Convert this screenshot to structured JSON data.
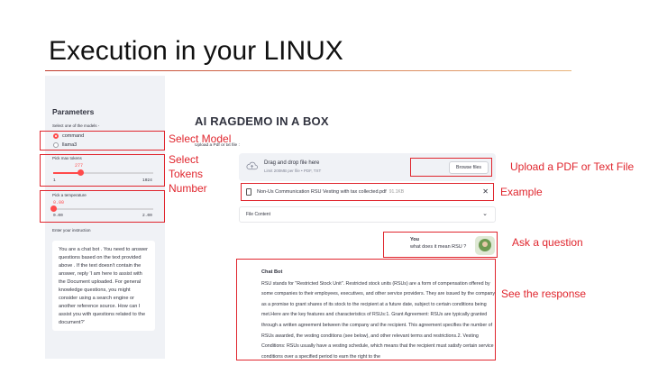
{
  "slide": {
    "title": "Execution in your LINUX"
  },
  "sidebar": {
    "title": "Parameters",
    "model_label": "Select one of the models -",
    "models": [
      "command",
      "llama3"
    ],
    "selected_model": "command",
    "tokens": {
      "label": "Pick max tokens",
      "value": "277",
      "min": "1",
      "max": "1024",
      "fraction": 0.27
    },
    "temperature": {
      "label": "Pick a temperature",
      "value": "0.00",
      "min": "0.00",
      "max": "2.00",
      "fraction": 0.0
    },
    "instruction_label": "Enter your instruction",
    "instruction_text": "You are a chat bot . You need to answer questions based on the text provided above . If the text doesn't contain the answer, reply 'I am here to assist with the Document uploaded. For general knowledge questions, you might consider using a search engine or another reference source. How can I assist you with questions related to the document?'"
  },
  "main": {
    "title": "AI RAGDEMO IN A BOX",
    "upload_label": "Upload a Pdf or txt file :",
    "dropzone_title": "Drag and drop file here",
    "dropzone_sub": "Limit 200MB per file • PDF, TXT",
    "browse_label": "Browse files",
    "file_name": "Non-Us Communication RSU Vesting with tax collected.pdf",
    "file_size": "91.1KB",
    "expander_label": "File Content",
    "user_name": "You",
    "user_question": "what does it mean RSU ?",
    "bot_name": "Chat Bot",
    "bot_response": "RSU stands for \"Restricted Stock Unit\". Restricted stock units (RSUs) are a form of compensation offered by some companies to their employees, executives, and other service providers. They are issued by the company as a promise to grant shares of its stock to the recipient at a future date, subject to certain conditions being met.Here are the key features and characteristics of RSUs:1. Grant Agreement: RSUs are typically granted through a written agreement between the company and the recipient. This agreement specifies the number of RSUs awarded, the vesting conditions (see below), and other relevant terms and restrictions.2. Vesting Conditions: RSUs usually have a vesting schedule, which means that the recipient must satisfy certain service conditions over a specified period to earn the right to the"
  },
  "annotations": {
    "select_model": "Select Model",
    "select_tokens": "Select\nTokens\nNumber",
    "upload": "Upload a PDF or Text File",
    "example": "Example",
    "ask": "Ask a question",
    "response": "See the response"
  },
  "colors": {
    "accent": "#ff4b4b",
    "annotation": "#e0262e",
    "sidebar_bg": "#f0f2f6"
  }
}
